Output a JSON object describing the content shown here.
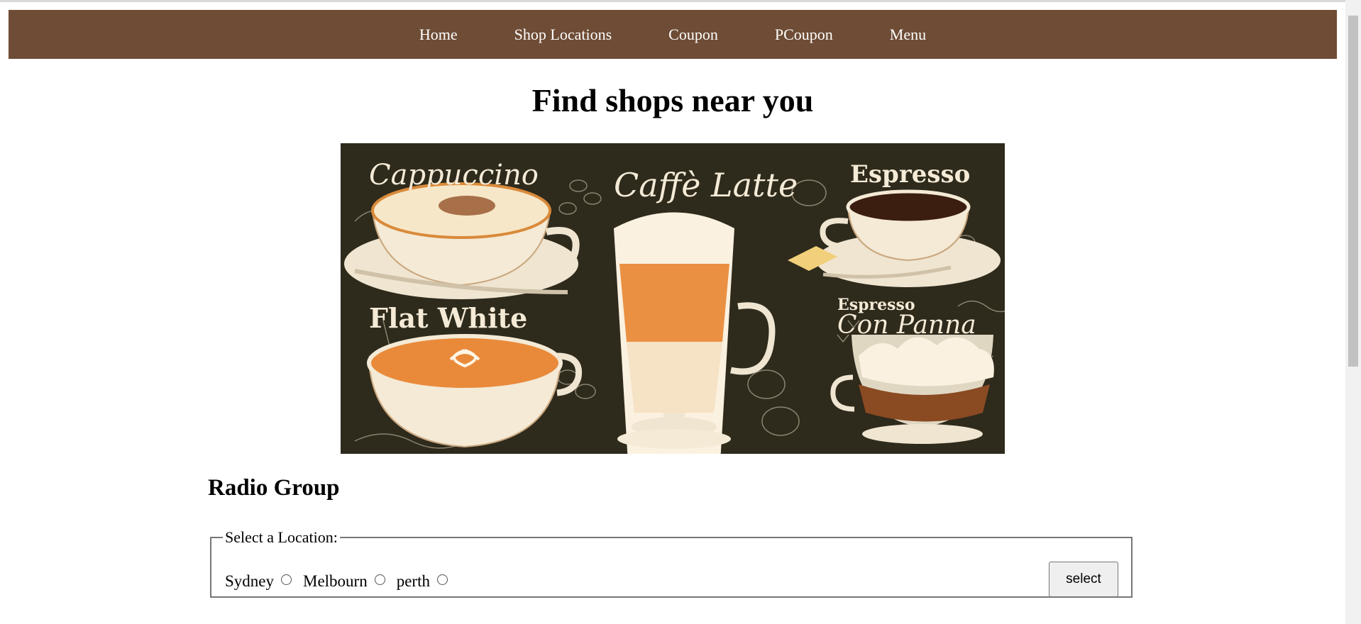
{
  "nav": {
    "items": [
      {
        "label": "Home"
      },
      {
        "label": "Shop Locations"
      },
      {
        "label": "Coupon"
      },
      {
        "label": "PCoupon"
      },
      {
        "label": "Menu"
      }
    ]
  },
  "page": {
    "title": "Find shops near you"
  },
  "hero": {
    "labels": {
      "cappuccino": "Cappuccino",
      "latte": "Caffè Latte",
      "espresso": "Espresso",
      "flat_white": "Flat White",
      "con_panna_top": "Espresso",
      "con_panna": "Con Panna"
    },
    "colors": {
      "board": "#2e2a1c",
      "cream": "#f4ead6",
      "orange": "#e98a3a",
      "coffee": "#3b1e10"
    }
  },
  "radio_group": {
    "heading": "Radio Group",
    "legend": "Select a Location:",
    "options": [
      {
        "label": "Sydney"
      },
      {
        "label": "Melbourn"
      },
      {
        "label": "perth"
      }
    ],
    "button_label": "select"
  },
  "colors": {
    "nav_background": "#6e4c35",
    "nav_text": "#ffffff"
  }
}
